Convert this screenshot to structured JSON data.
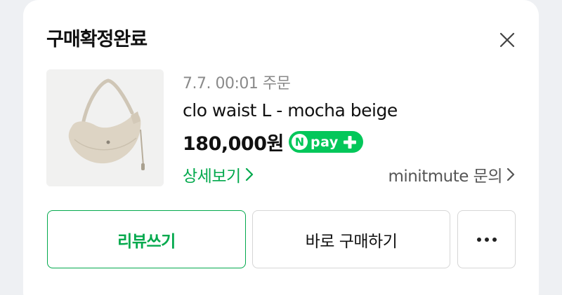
{
  "dialog": {
    "title": "구매확정완료"
  },
  "order": {
    "meta": "7.7. 00:01 주문",
    "product_name": "clo waist L - mocha beige",
    "price": "180,000원",
    "npay_label": "pay",
    "npay_n": "N",
    "detail_link": "상세보기",
    "seller_link": "minitmute 문의"
  },
  "actions": {
    "review": "리뷰쓰기",
    "buy_again": "바로 구매하기"
  },
  "colors": {
    "accent_green": "#03a94d",
    "npay_green": "#03c75a",
    "background": "#eef0f3"
  },
  "icons": {
    "close": "close-icon",
    "chevron": "chevron-right-icon",
    "more": "more-dots-icon",
    "npay_plus": "plus-icon"
  }
}
